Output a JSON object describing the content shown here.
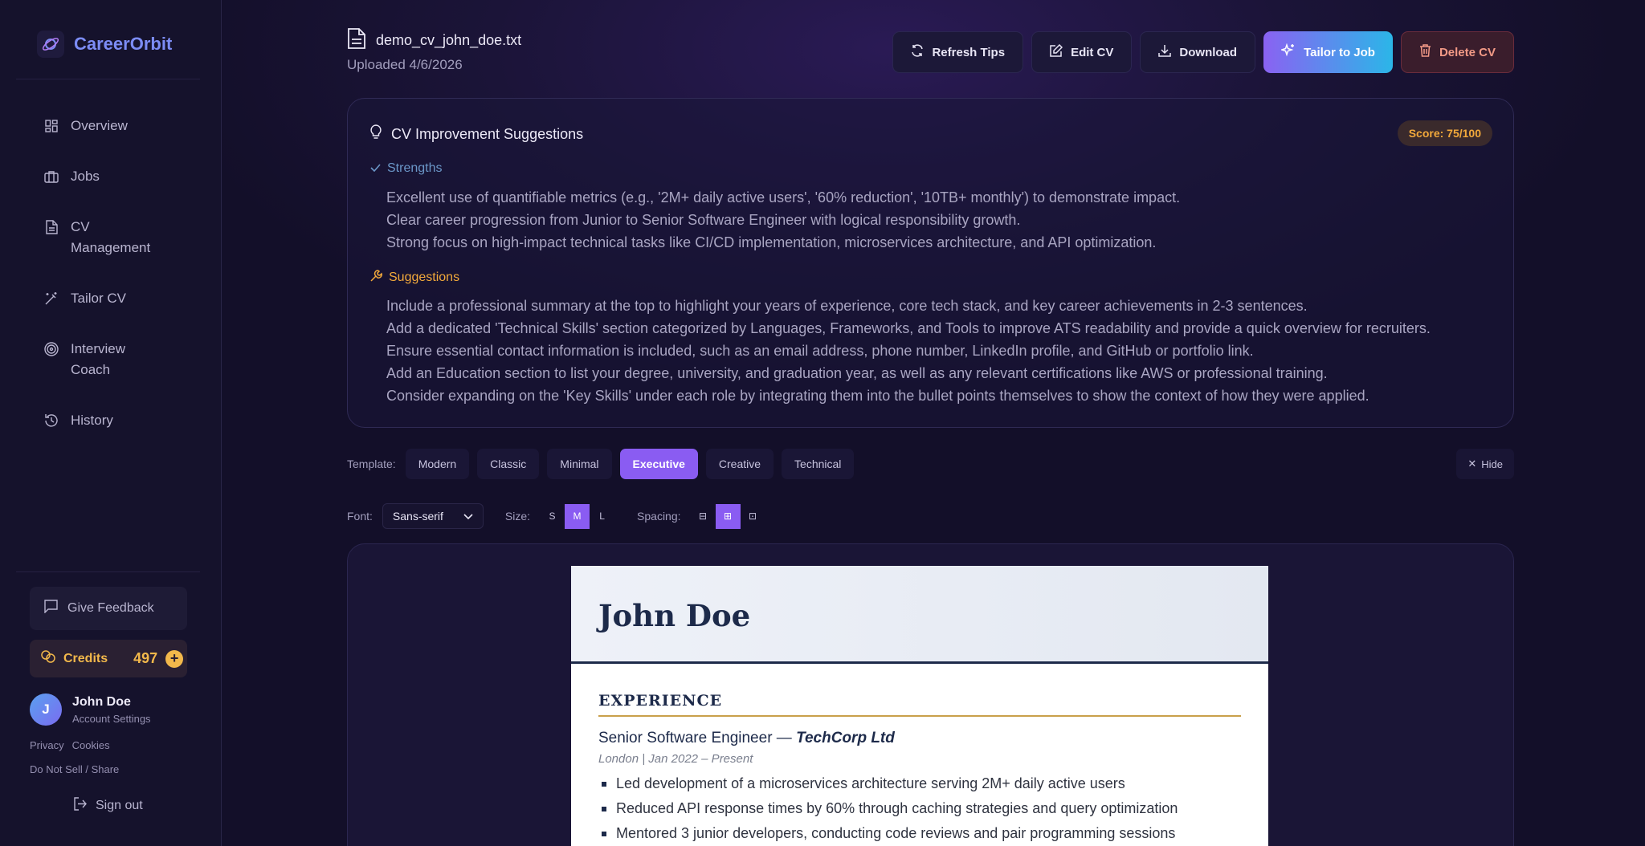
{
  "brand": {
    "name": "CareerOrbit"
  },
  "nav": [
    {
      "label": "Overview",
      "icon": "grid-icon"
    },
    {
      "label": "Jobs",
      "icon": "briefcase-icon"
    },
    {
      "label": "CV Management",
      "icon": "document-icon"
    },
    {
      "label": "Tailor CV",
      "icon": "magic-wand-icon"
    },
    {
      "label": "Interview Coach",
      "icon": "target-icon"
    },
    {
      "label": "History",
      "icon": "history-icon"
    }
  ],
  "sidebar": {
    "feedback_label": "Give Feedback",
    "credits_label": "Credits",
    "credits_value": "497",
    "user_name": "John Doe",
    "user_sub": "Account Settings",
    "avatar_initial": "J",
    "privacy": "Privacy",
    "cookies": "Cookies",
    "do_not_sell": "Do Not Sell / Share",
    "sign_out": "Sign out"
  },
  "file": {
    "name": "demo_cv_john_doe.txt",
    "uploaded": "Uploaded 4/6/2026"
  },
  "actions": {
    "refresh": "Refresh Tips",
    "edit": "Edit CV",
    "download": "Download",
    "tailor": "Tailor to Job",
    "delete": "Delete CV"
  },
  "suggestions": {
    "title": "CV Improvement Suggestions",
    "score": "Score: 75/100",
    "strengths_label": "Strengths",
    "strengths": [
      "Excellent use of quantifiable metrics (e.g., '2M+ daily active users', '60% reduction', '10TB+ monthly') to demonstrate impact.",
      "Clear career progression from Junior to Senior Software Engineer with logical responsibility growth.",
      "Strong focus on high-impact technical tasks like CI/CD implementation, microservices architecture, and API optimization."
    ],
    "suggestions_label": "Suggestions",
    "suggestions": [
      "Include a professional summary at the top to highlight your years of experience, core tech stack, and key career achievements in 2-3 sentences.",
      "Add a dedicated 'Technical Skills' section categorized by Languages, Frameworks, and Tools to improve ATS readability and provide a quick overview for recruiters.",
      "Ensure essential contact information is included, such as an email address, phone number, LinkedIn profile, and GitHub or portfolio link.",
      "Add an Education section to list your degree, university, and graduation year, as well as any relevant certifications like AWS or professional training.",
      "Consider expanding on the 'Key Skills' under each role by integrating them into the bullet points themselves to show the context of how they were applied."
    ]
  },
  "templates": {
    "label": "Template:",
    "items": [
      "Modern",
      "Classic",
      "Minimal",
      "Executive",
      "Creative",
      "Technical"
    ],
    "active": "Executive",
    "hide": "Hide"
  },
  "format": {
    "font_label": "Font:",
    "font_value": "Sans-serif",
    "size_label": "Size:",
    "sizes": [
      "S",
      "M",
      "L"
    ],
    "size_active": "M",
    "spacing_label": "Spacing:",
    "spacing_options": [
      "⊟",
      "⊞",
      "⊡"
    ],
    "spacing_active": 1
  },
  "cv": {
    "name": "John Doe",
    "section": "EXPERIENCE",
    "role_title": "Senior Software Engineer — ",
    "company": "TechCorp Ltd",
    "meta": "London | Jan 2022 – Present",
    "bullets": [
      "Led development of a microservices architecture serving 2M+ daily active users",
      "Reduced API response times by 60% through caching strategies and query optimization",
      "Mentored 3 junior developers, conducting code reviews and pair programming sessions"
    ]
  }
}
